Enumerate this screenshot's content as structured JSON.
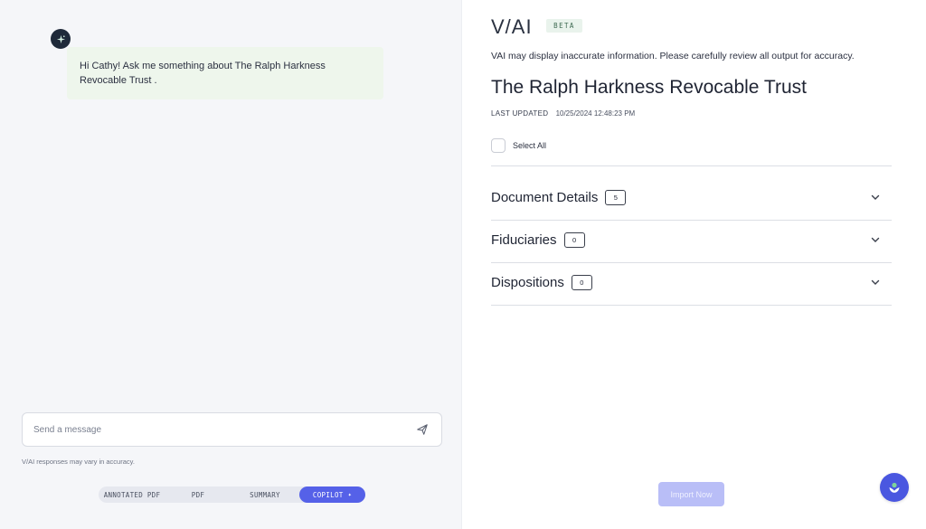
{
  "chat": {
    "greeting": "Hi Cathy! Ask me something about The Ralph Harkness Revocable Trust .",
    "input_placeholder": "Send a message",
    "disclaimer": "V/AI responses may vary in accuracy."
  },
  "tabs": [
    {
      "label": "ANNOTATED PDF",
      "active": false
    },
    {
      "label": "PDF",
      "active": false
    },
    {
      "label": "SUMMARY",
      "active": false
    },
    {
      "label": "COPILOT",
      "active": true,
      "icon": "sparkle-icon"
    }
  ],
  "header": {
    "brand": "V/AI",
    "badge": "BETA",
    "warning": "VAI may display inaccurate information. Please carefully review all output for accuracy."
  },
  "document": {
    "title": "The Ralph Harkness Revocable Trust",
    "updated_label": "LAST UPDATED",
    "updated_value": "10/25/2024 12:48:23 PM"
  },
  "select_all_label": "Select All",
  "sections": [
    {
      "title": "Document Details",
      "count": "5"
    },
    {
      "title": "Fiduciaries",
      "count": "0"
    },
    {
      "title": "Dispositions",
      "count": "0"
    }
  ],
  "import_label": "Import Now",
  "colors": {
    "accent": "#5561e8",
    "bubble_bg": "#eef6ec",
    "import_disabled": "#b9bef7",
    "badge_bg": "#e9f3ec"
  }
}
